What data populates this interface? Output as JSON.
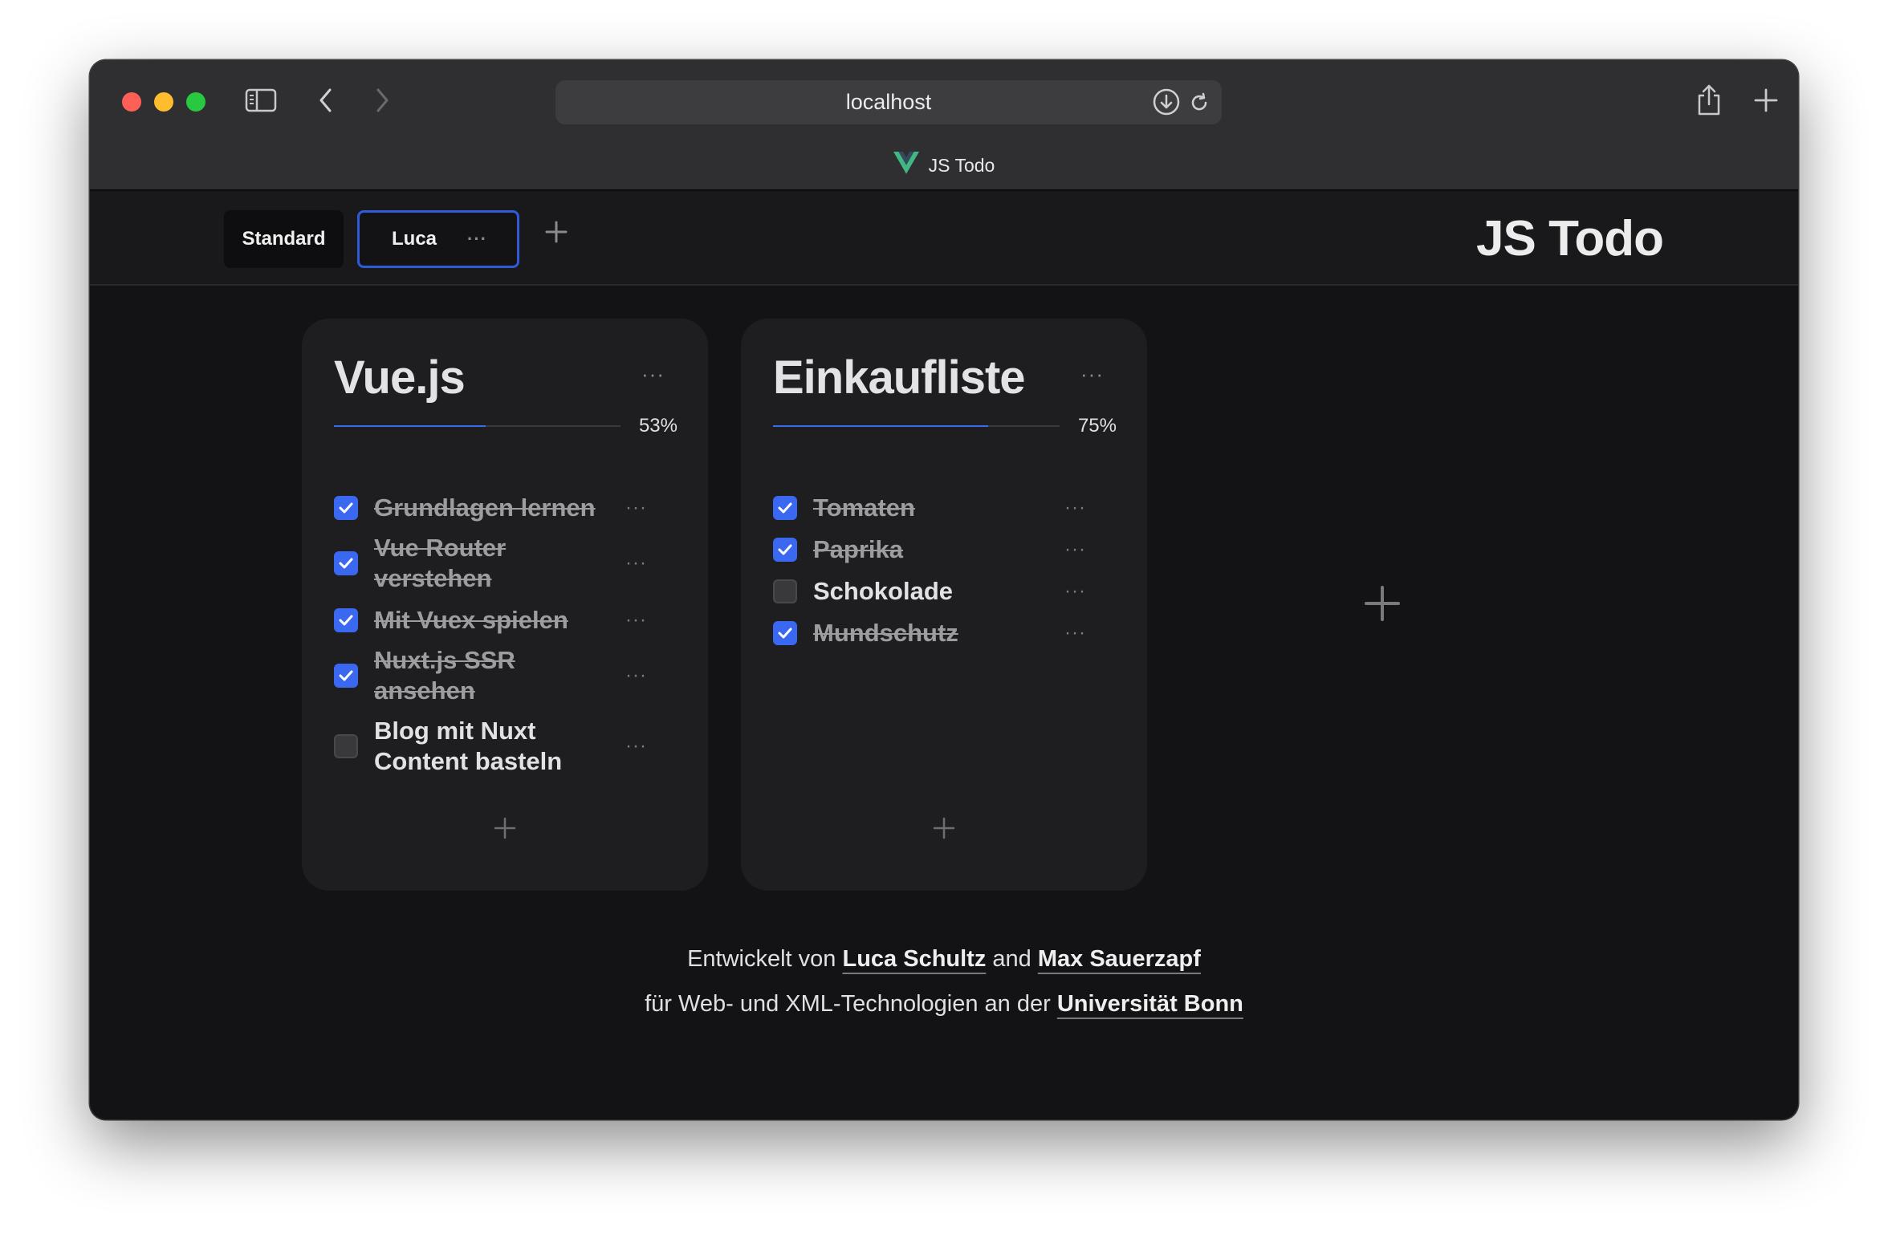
{
  "browser": {
    "url": "localhost",
    "tab_title": "JS Todo"
  },
  "app": {
    "title": "JS Todo",
    "tabs": [
      {
        "label": "Standard",
        "active": false
      },
      {
        "label": "Luca",
        "active": true,
        "menu": "···"
      }
    ]
  },
  "lists": [
    {
      "title": "Vue.js",
      "menu": "···",
      "progress": 0.53,
      "progress_label": "53%",
      "items": [
        {
          "text": "Grundlagen lernen",
          "done": true
        },
        {
          "text": "Vue Router verstehen",
          "done": true
        },
        {
          "text": "Mit Vuex spielen",
          "done": true
        },
        {
          "text": "Nuxt.js SSR ansehen",
          "done": true
        },
        {
          "text": "Blog mit Nuxt Content basteln",
          "done": false
        }
      ]
    },
    {
      "title": "Einkaufliste",
      "menu": "···",
      "progress": 0.75,
      "progress_label": "75%",
      "items": [
        {
          "text": "Tomaten",
          "done": true
        },
        {
          "text": "Paprika",
          "done": true
        },
        {
          "text": "Schokolade",
          "done": false
        },
        {
          "text": "Mundschutz",
          "done": true
        }
      ]
    }
  ],
  "item_menu": "···",
  "footer": {
    "line1_prefix": "Entwickelt von",
    "author1": "Luca Schultz",
    "line1_and": "and",
    "author2": "Max Sauerzapf",
    "line2_prefix": "für Web- und XML-Technologien an der",
    "university": "Universität Bonn"
  },
  "colors": {
    "accent": "#3a68f0",
    "vue_green": "#41b883",
    "background": "#131315",
    "card": "#1e1e20"
  }
}
